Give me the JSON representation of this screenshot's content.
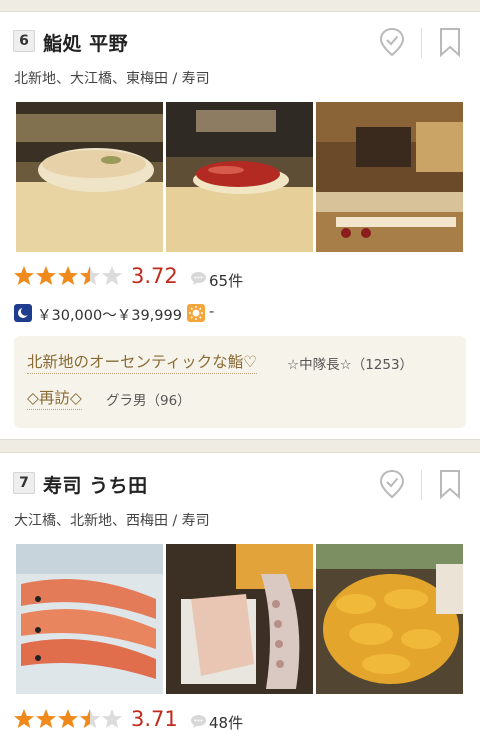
{
  "restaurants": [
    {
      "rank": "6",
      "name": "鮨処 平野",
      "area": "北新地、大江橋、東梅田 / 寿司",
      "rating": "3.72",
      "reviews": "65件",
      "dinner_price": "￥30,000～￥39,999",
      "lunch_price": "-",
      "stars_value": 3.5,
      "review_snippets": [
        {
          "title": "北新地のオーセンティックな鮨♡",
          "user": "☆中隊長☆（1253）"
        },
        {
          "title": "◇再訪◇",
          "user": "グラ男（96）"
        }
      ]
    },
    {
      "rank": "7",
      "name": "寿司 うち田",
      "area": "大江橋、北新地、西梅田 / 寿司",
      "rating": "3.71",
      "reviews": "48件",
      "stars_value": 3.5
    }
  ],
  "colors": {
    "star": "#f08a1c",
    "score": "#c22a1b",
    "divider": "#efede3"
  },
  "icons": [
    "map-pin-check-icon",
    "bookmark-icon",
    "speech-bubble-icon",
    "moon-icon",
    "sun-icon"
  ]
}
